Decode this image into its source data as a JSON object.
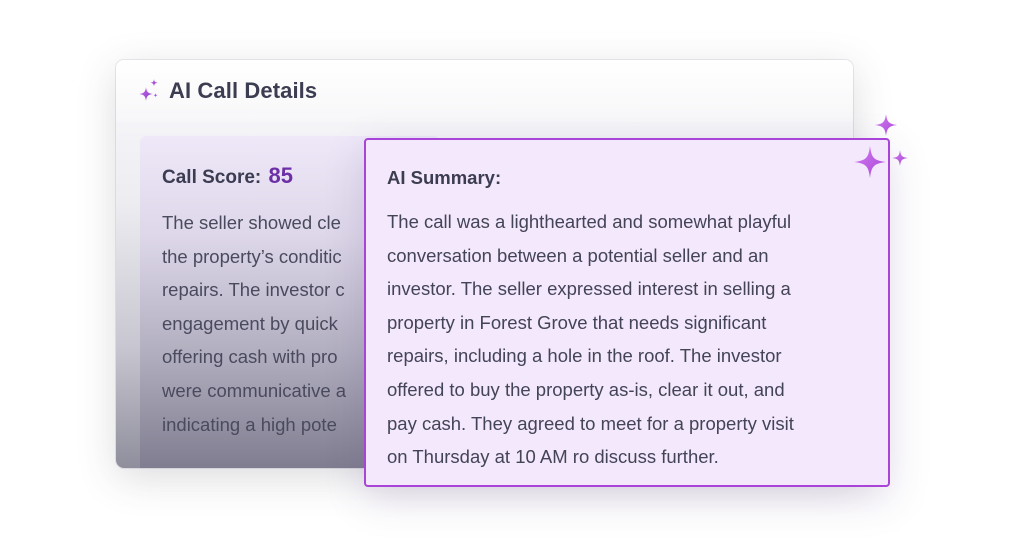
{
  "details": {
    "title": "AI Call Details",
    "header_icon": "sparkles-icon"
  },
  "score": {
    "label": "Call Score:",
    "value": "85",
    "text_lines": [
      "The seller showed cle",
      "the property’s conditic",
      "repairs. The investor c",
      "engagement by quick",
      "offering cash with pro",
      "were communicative a",
      "indicating a high pote"
    ]
  },
  "summary": {
    "title": "AI Summary:",
    "text_lines": [
      "The call was a lighthearted and somewhat playful",
      "conversation between a potential seller and an",
      "investor. The seller expressed interest in selling a",
      "property in Forest Grove that needs significant",
      "repairs, including a hole in the roof. The investor",
      "offered to buy the property as-is, clear it out, and",
      "pay cash. They agreed to meet for a property visit",
      "on Thursday at 10 AM ro discuss further."
    ]
  },
  "colors": {
    "accent": "#a845d8",
    "score_value": "#6b2fa6",
    "summary_bg": "#f4e8fc"
  }
}
